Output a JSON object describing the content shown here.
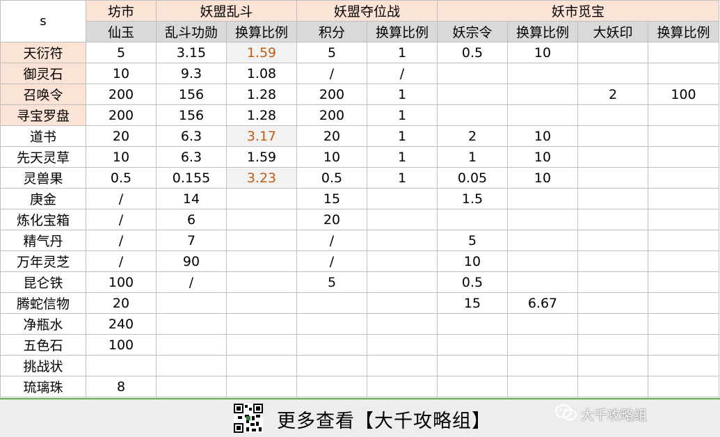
{
  "corner_label": "s",
  "groups": [
    {
      "label": "坊市",
      "span": 1
    },
    {
      "label": "妖盟乱斗",
      "span": 2
    },
    {
      "label": "妖盟夺位战",
      "span": 2
    },
    {
      "label": "妖市觅宝",
      "span": 4
    }
  ],
  "subheaders": [
    "仙玉",
    "乱斗功勋",
    "换算比例",
    "积分",
    "换算比例",
    "妖宗令",
    "换算比例",
    "大妖印",
    "换算比例"
  ],
  "rows": [
    {
      "name": "天衍符",
      "highlight": true,
      "cells": [
        "5",
        "3.15",
        "1.59",
        "5",
        "1",
        "0.5",
        "10",
        "",
        ""
      ],
      "ratio_style": "orange"
    },
    {
      "name": "御灵石",
      "highlight": true,
      "cells": [
        "10",
        "9.3",
        "1.08",
        "/",
        "/",
        "",
        "",
        "",
        ""
      ],
      "ratio_style": "plain"
    },
    {
      "name": "召唤令",
      "highlight": true,
      "cells": [
        "200",
        "156",
        "1.28",
        "200",
        "1",
        "",
        "",
        "2",
        "100"
      ],
      "ratio_style": "plain"
    },
    {
      "name": "寻宝罗盘",
      "highlight": true,
      "cells": [
        "200",
        "156",
        "1.28",
        "200",
        "1",
        "",
        "",
        "",
        ""
      ],
      "ratio_style": "plain"
    },
    {
      "name": "道书",
      "highlight": false,
      "cells": [
        "20",
        "6.3",
        "3.17",
        "20",
        "1",
        "2",
        "10",
        "",
        ""
      ],
      "ratio_style": "orange"
    },
    {
      "name": "先天灵草",
      "highlight": false,
      "cells": [
        "10",
        "6.3",
        "1.59",
        "10",
        "1",
        "1",
        "10",
        "",
        ""
      ],
      "ratio_style": "plain"
    },
    {
      "name": "灵兽果",
      "highlight": false,
      "cells": [
        "0.5",
        "0.155",
        "3.23",
        "0.5",
        "1",
        "0.05",
        "10",
        "",
        ""
      ],
      "ratio_style": "orange"
    },
    {
      "name": "庚金",
      "highlight": false,
      "cells": [
        "/",
        "14",
        "",
        "15",
        "",
        "1.5",
        "",
        "",
        ""
      ],
      "ratio_style": "plain"
    },
    {
      "name": "炼化宝箱",
      "highlight": false,
      "cells": [
        "/",
        "6",
        "",
        "20",
        "",
        "",
        "",
        "",
        ""
      ],
      "ratio_style": "plain"
    },
    {
      "name": "精气丹",
      "highlight": false,
      "cells": [
        "/",
        "7",
        "",
        "/",
        "",
        "5",
        "",
        "",
        ""
      ],
      "ratio_style": "plain"
    },
    {
      "name": "万年灵芝",
      "highlight": false,
      "cells": [
        "/",
        "90",
        "",
        "/",
        "",
        "10",
        "",
        "",
        ""
      ],
      "ratio_style": "plain"
    },
    {
      "name": "昆仑铁",
      "highlight": false,
      "cells": [
        "100",
        "/",
        "",
        "5",
        "",
        "0.5",
        "",
        "",
        ""
      ],
      "ratio_style": "plain"
    },
    {
      "name": "腾蛇信物",
      "highlight": false,
      "cells": [
        "20",
        "",
        "",
        "",
        "",
        "15",
        "6.67",
        "",
        ""
      ],
      "ratio_style": "plain"
    },
    {
      "name": "净瓶水",
      "highlight": false,
      "cells": [
        "240",
        "",
        "",
        "",
        "",
        "",
        "",
        "",
        ""
      ],
      "ratio_style": "plain"
    },
    {
      "name": "五色石",
      "highlight": false,
      "cells": [
        "100",
        "",
        "",
        "",
        "",
        "",
        "",
        "",
        ""
      ],
      "ratio_style": "plain"
    },
    {
      "name": "挑战状",
      "highlight": false,
      "cells": [
        "",
        "",
        "",
        "",
        "",
        "",
        "",
        "",
        ""
      ],
      "ratio_style": "plain"
    },
    {
      "name": "琉璃珠",
      "highlight": false,
      "cells": [
        "8",
        "",
        "",
        "",
        "",
        "",
        "",
        "",
        ""
      ],
      "ratio_style": "plain"
    }
  ],
  "footer": {
    "text": "更多查看【大千攻略组】",
    "watermark": "大千攻略组",
    "qr_icon": "qr-code-icon",
    "wechat_icon": "wechat-icon"
  },
  "colors": {
    "header_peach": "#fbe4d5",
    "subheader_grey": "#d9d9d9",
    "ratio_orange": "#c55a11",
    "footer_bg": "#ededed",
    "footer_border": "#6aa84f"
  }
}
